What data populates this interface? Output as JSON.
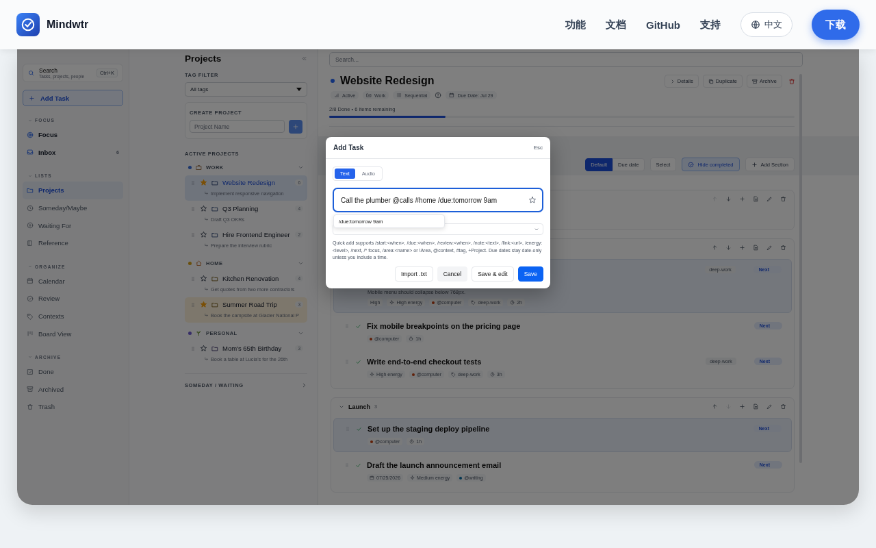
{
  "nav": {
    "brand": "Mindwtr",
    "links": [
      {
        "label": "功能"
      },
      {
        "label": "文档"
      },
      {
        "label": "GitHub"
      },
      {
        "label": "支持"
      }
    ],
    "language": "中文",
    "download": "下载"
  },
  "sidebar": {
    "search": {
      "label": "Search",
      "hint": "Tasks, projects, people",
      "shortcut": "Ctrl+K"
    },
    "add_task": "Add Task",
    "groups": [
      {
        "title": "FOCUS",
        "items": [
          {
            "label": "Focus",
            "selected": false
          },
          {
            "label": "Inbox",
            "count": "6",
            "selected": false
          }
        ]
      },
      {
        "title": "LISTS",
        "items": [
          {
            "label": "Projects",
            "selected": true
          },
          {
            "label": "Someday/Maybe",
            "selected": false
          },
          {
            "label": "Waiting For",
            "selected": false
          },
          {
            "label": "Reference",
            "selected": false
          }
        ]
      },
      {
        "title": "ORGANIZE",
        "items": [
          {
            "label": "Calendar",
            "selected": false
          },
          {
            "label": "Review",
            "selected": false
          },
          {
            "label": "Contexts",
            "selected": false
          },
          {
            "label": "Board View",
            "selected": false
          }
        ]
      },
      {
        "title": "ARCHIVE",
        "items": [
          {
            "label": "Done",
            "selected": false
          },
          {
            "label": "Archived",
            "selected": false
          },
          {
            "label": "Trash",
            "selected": false
          }
        ]
      }
    ]
  },
  "projects_panel": {
    "title": "Projects",
    "tag_filter": {
      "label": "TAG FILTER",
      "value": "All tags"
    },
    "create": {
      "label": "CREATE PROJECT",
      "placeholder": "Project Name"
    },
    "active_label": "ACTIVE PROJECTS",
    "areas": [
      {
        "name": "WORK",
        "color": "#1e386c",
        "projects": [
          {
            "name": "Website Redesign",
            "count": "6",
            "next": "Implement responsive navigation",
            "starred": true,
            "selected": true,
            "highlighted": false
          },
          {
            "name": "Q3 Planning",
            "count": "4",
            "next": "Draft Q3 OKRs",
            "starred": false,
            "selected": false,
            "highlighted": false
          },
          {
            "name": "Hire Frontend Engineer",
            "count": "2",
            "next": "Prepare the interview rubric",
            "starred": false,
            "selected": false,
            "highlighted": false
          }
        ]
      },
      {
        "name": "HOME",
        "color": "#6a500c",
        "projects": [
          {
            "name": "Kitchen Renovation",
            "count": "4",
            "next": "Get quotes from two more contractors",
            "starred": false,
            "selected": false,
            "highlighted": false
          },
          {
            "name": "Summer Road Trip",
            "count": "3",
            "next": "Book the campsite at Glacier National P",
            "starred": true,
            "selected": false,
            "highlighted": true
          }
        ]
      },
      {
        "name": "PERSONAL",
        "color": "#372e68",
        "projects": [
          {
            "name": "Mom's 65th Birthday",
            "count": "3",
            "next": "Book a table at Lucia's for the 26th",
            "starred": false,
            "selected": false,
            "highlighted": false
          }
        ]
      }
    ],
    "someday": "SOMEDAY / WAITING"
  },
  "project": {
    "search_placeholder": "Search...",
    "title": "Website Redesign",
    "color": "#13337a",
    "meta": [
      {
        "kind": "status",
        "label": "Active"
      },
      {
        "kind": "area",
        "label": "Work"
      },
      {
        "kind": "mode",
        "label": "Sequential"
      },
      {
        "kind": "help"
      },
      {
        "kind": "date",
        "label": "Due Date: Jul 29"
      }
    ],
    "actions": [
      {
        "kind": "details",
        "label": "Details"
      },
      {
        "kind": "duplicate",
        "label": "Duplicate"
      },
      {
        "kind": "archive",
        "label": "Archive"
      },
      {
        "kind": "delete"
      }
    ],
    "progress": {
      "text": "2/8 Done • 6 items remaining",
      "level": 0.25
    }
  },
  "toolbar": {
    "sort": [
      {
        "label": "Default",
        "selected": true
      },
      {
        "label": "Due date",
        "selected": false
      }
    ],
    "select": "Select",
    "hide_completed": {
      "label": "Hide completed",
      "on": true
    },
    "add_section": "Add Section"
  },
  "sections": [
    {
      "can_move_up": false,
      "can_move_down": true
    },
    {
      "can_move_up": true,
      "can_move_down": true,
      "tasks": [
        {
          "note": "Mobile menu should collapse below 768px.",
          "chips": [
            {
              "kind": "priority",
              "label": "High"
            },
            {
              "kind": "energy",
              "label": "High energy"
            },
            {
              "kind": "context",
              "label": "@computer",
              "color": "#61210a"
            },
            {
              "kind": "tag",
              "label": "deep-work"
            },
            {
              "kind": "duration",
              "label": "2h"
            }
          ],
          "tag": "deep-work",
          "status": "Next",
          "highlighted": true
        },
        {
          "title": "Fix mobile breakpoints on the pricing page",
          "chips": [
            {
              "kind": "context",
              "label": "@computer",
              "color": "#61210a"
            },
            {
              "kind": "duration",
              "label": "1h"
            }
          ],
          "status": "Next",
          "highlighted": false
        },
        {
          "title": "Write end-to-end checkout tests",
          "chips": [
            {
              "kind": "energy",
              "label": "High energy"
            },
            {
              "kind": "context",
              "label": "@computer",
              "color": "#61210a"
            },
            {
              "kind": "tag",
              "label": "deep-work"
            },
            {
              "kind": "duration",
              "label": "3h"
            }
          ],
          "tag": "deep-work",
          "status": "Next",
          "highlighted": false
        }
      ]
    },
    {
      "title": "Launch",
      "count": "3",
      "can_move_up": true,
      "can_move_down": false,
      "tasks": [
        {
          "title": "Set up the staging deploy pipeline",
          "chips": [
            {
              "kind": "context",
              "label": "@computer",
              "color": "#61210a"
            },
            {
              "kind": "duration",
              "label": "1h"
            }
          ],
          "status": "Next",
          "highlighted": true
        },
        {
          "title": "Draft the launch announcement email",
          "chips": [
            {
              "kind": "date",
              "label": "07/25/2026"
            },
            {
              "kind": "energy",
              "label": "Medium energy"
            },
            {
              "kind": "context",
              "label": "@writing",
              "color": "#023550"
            }
          ],
          "status": "Next",
          "highlighted": false
        }
      ]
    }
  ],
  "dialog": {
    "title": "Add Task",
    "close_hint": "Esc",
    "modes": [
      {
        "label": "Text",
        "selected": true
      },
      {
        "label": "Audio",
        "selected": false
      }
    ],
    "value": "Call the plumber @calls #home /due:tomorrow 9am",
    "suggestion": "/due:tomorrow 9am",
    "help": "Quick add supports /start:<when>, /due:<when>, /review:<when>, /note:<text>, /link:<url>, /energy:<level>, /next, /* focus, /area:<name> or !Area, @context, #tag, +Project. Due dates stay date-only unless you include a time.",
    "buttons": [
      {
        "kind": "secondary",
        "label": "Import .txt"
      },
      {
        "kind": "muted",
        "label": "Cancel"
      },
      {
        "kind": "secondary",
        "label": "Save & edit"
      },
      {
        "kind": "primary",
        "label": "Save"
      }
    ]
  }
}
